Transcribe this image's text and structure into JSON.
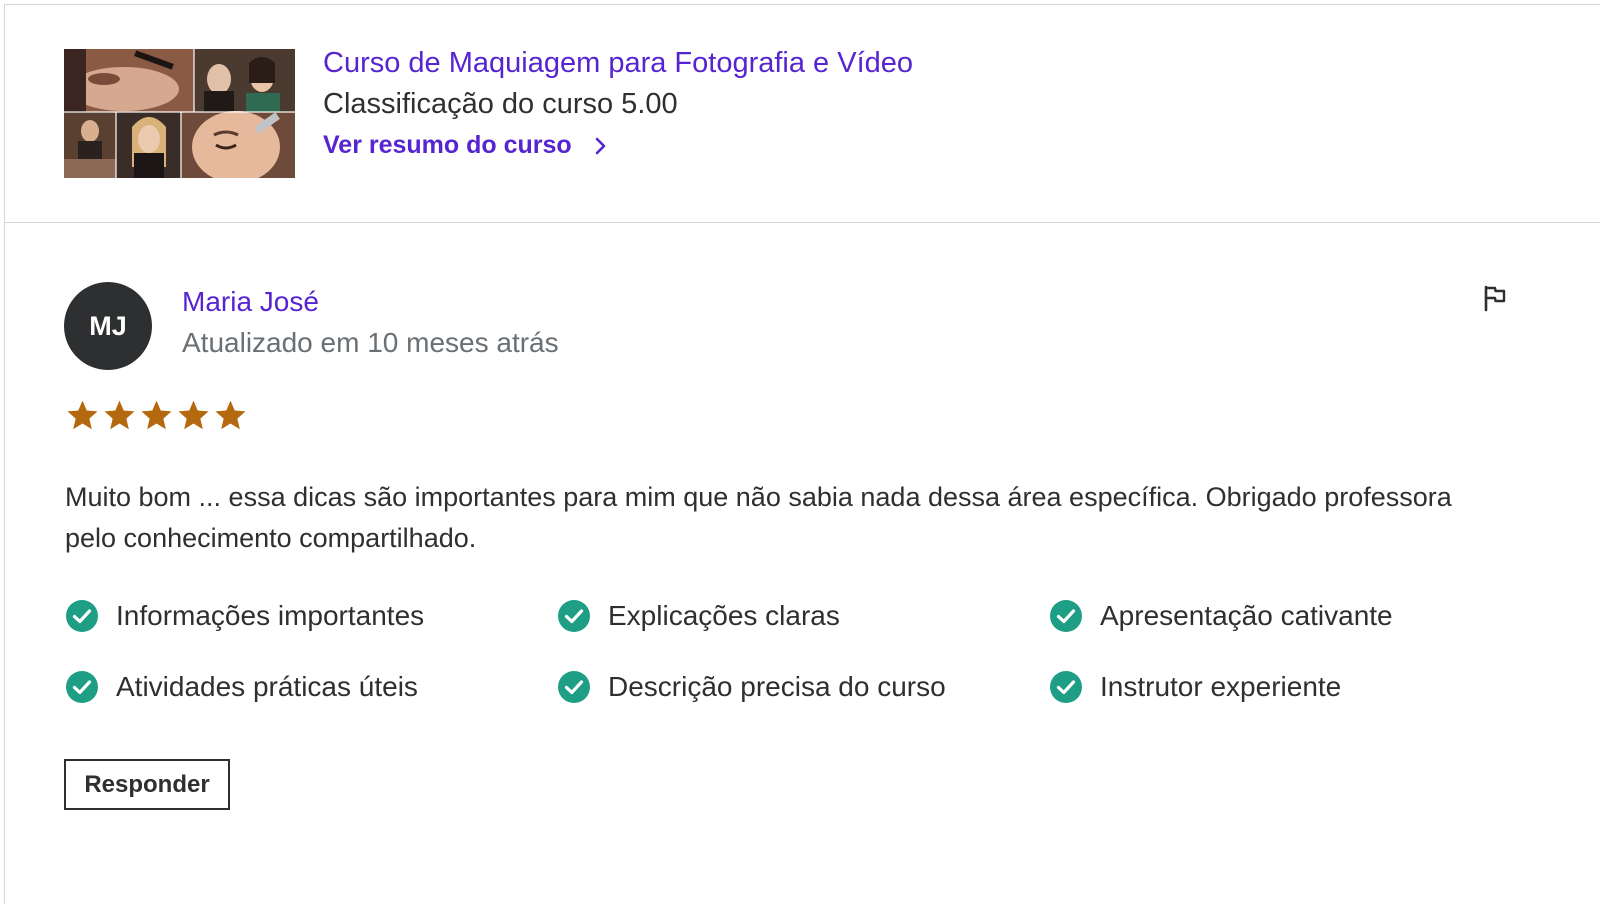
{
  "course": {
    "title": "Curso de Maquiagem para Fotografia e Vídeo",
    "rating_text": "Classificação do curso 5.00",
    "summary_link": "Ver resumo do curso",
    "thumbnail_alt": "course-thumbnail"
  },
  "review": {
    "avatar_initials": "MJ",
    "reviewer_name": "Maria José",
    "updated": "Atualizado em 10 meses atrás",
    "rating": 5,
    "rating_max": 5,
    "comment": "Muito bom ... essa dicas são importantes para mim que não sabia nada dessa área específica. Obrigado professora pelo conhecimento compartilhado.",
    "tags": [
      "Informações importantes",
      "Explicações claras",
      "Apresentação cativante",
      "Atividades práticas úteis",
      "Descrição precisa do curso",
      "Instrutor experiente"
    ],
    "reply_label": "Responder"
  },
  "icons": {
    "flag": "flag-icon",
    "star": "star-icon",
    "check": "check-circle-icon",
    "chevron": "chevron-right-icon"
  },
  "colors": {
    "link": "#5624d0",
    "star": "#b4690e",
    "check": "#1e9f85",
    "text": "#2d2f31",
    "muted": "#6a6f73",
    "border": "#d1d7dc",
    "avatar_bg": "#2d2f31"
  }
}
